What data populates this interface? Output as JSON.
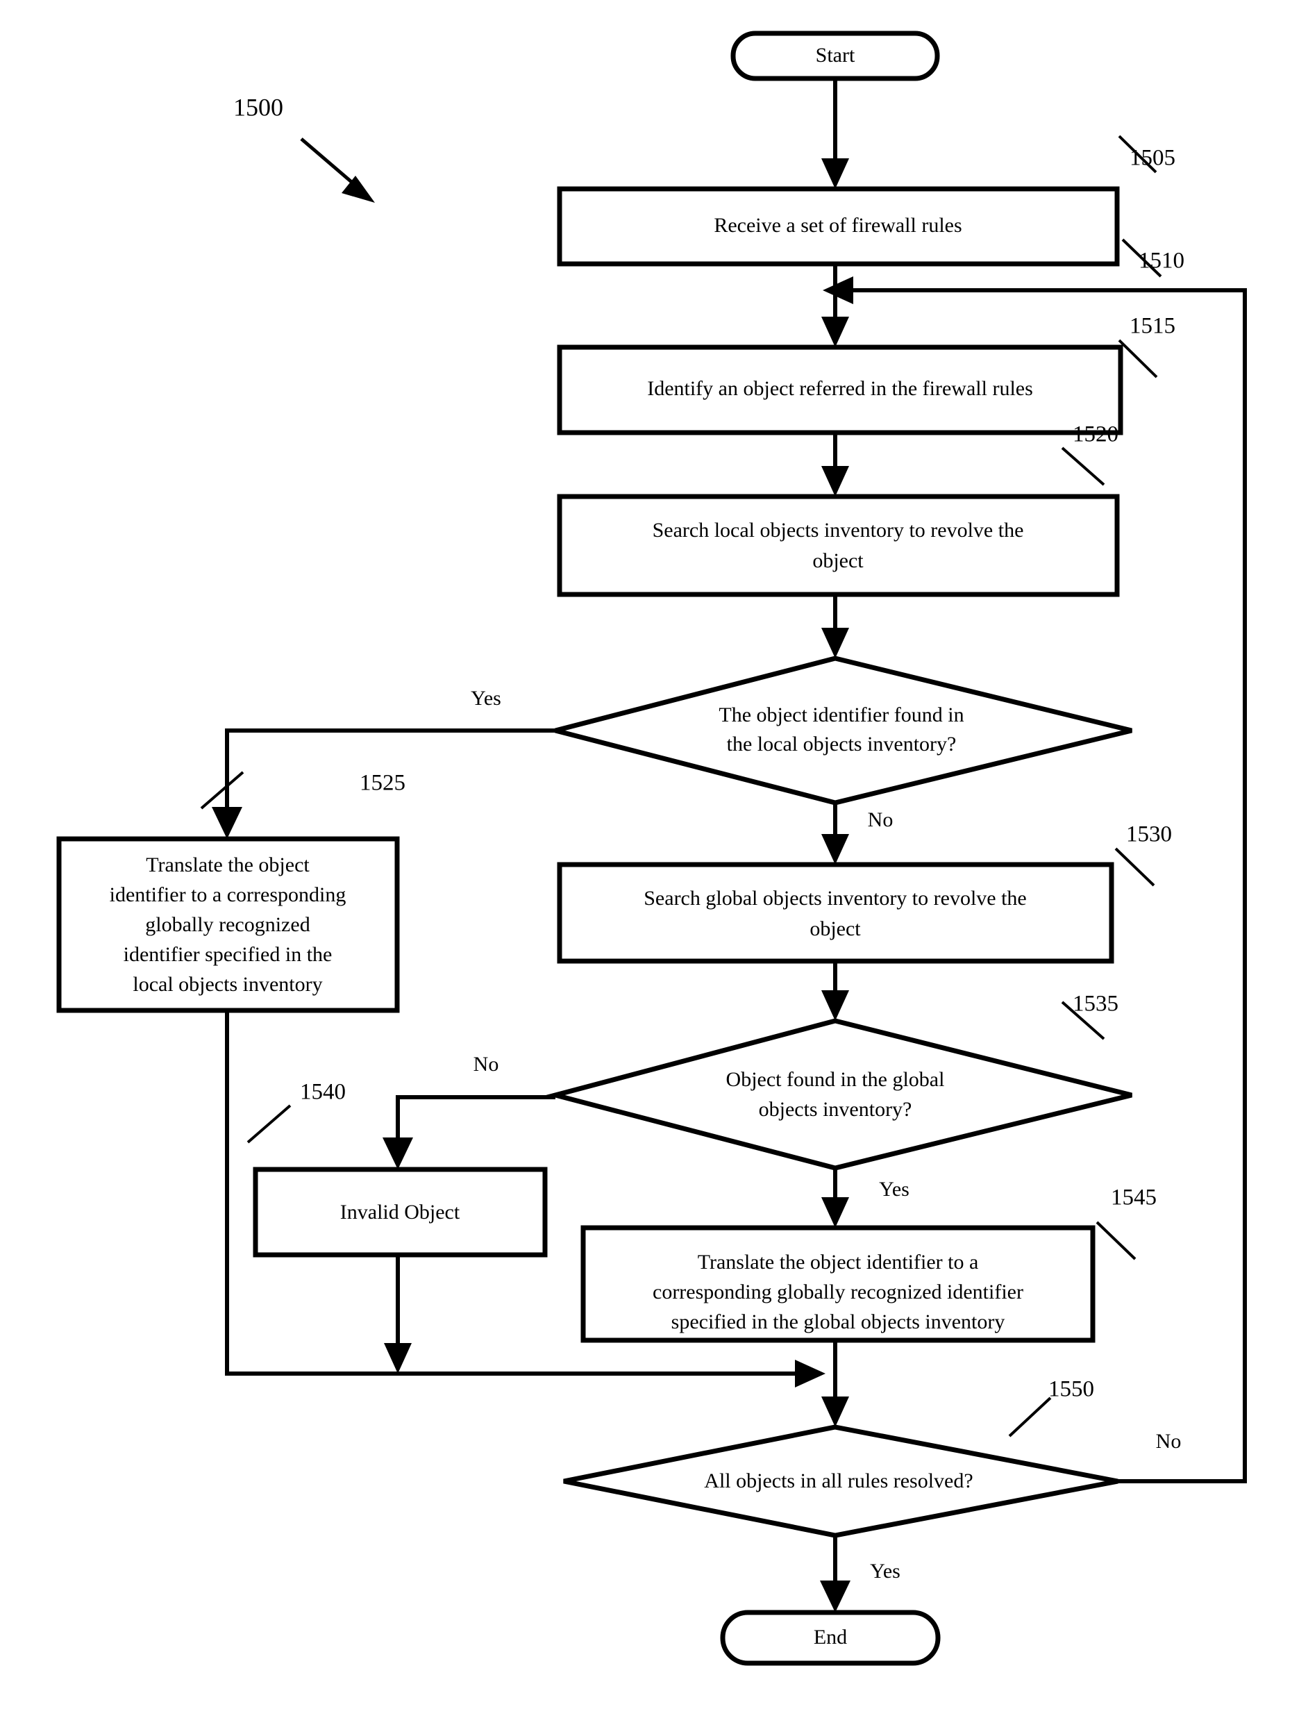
{
  "figure": {
    "number": "1500",
    "type": "flowchart"
  },
  "nodes": {
    "start": {
      "label": "Start",
      "shape": "terminator"
    },
    "receive_rules": {
      "label": "Receive a set of firewall rules",
      "ref": "1505",
      "shape": "process"
    },
    "identify_object": {
      "label": "Identify an object referred in the firewall rules",
      "ref": "1510",
      "shape": "process"
    },
    "search_local": {
      "line1": "Search local objects inventory to revolve the",
      "line2": "object",
      "ref": "1515",
      "shape": "process"
    },
    "decision_local": {
      "line1": "The object identifier found in",
      "line2": "the local objects inventory?",
      "ref": "1520",
      "shape": "decision"
    },
    "translate_local": {
      "line1": "Translate the object",
      "line2": "identifier to a corresponding",
      "line3": "globally recognized",
      "line4": "identifier specified in the",
      "line5": "local objects inventory",
      "ref": "1525",
      "shape": "process"
    },
    "search_global": {
      "line1": "Search global objects inventory to revolve the",
      "line2": "object",
      "ref": "1530",
      "shape": "process"
    },
    "decision_global": {
      "line1": "Object found in the global",
      "line2": "objects inventory?",
      "ref": "1535",
      "shape": "decision"
    },
    "invalid_object": {
      "label": "Invalid Object",
      "ref": "1540",
      "shape": "process"
    },
    "translate_global": {
      "line1": "Translate the object identifier to a",
      "line2": "corresponding globally recognized identifier",
      "line3": "specified in the global objects inventory",
      "ref": "1545",
      "shape": "process"
    },
    "decision_all_resolved": {
      "label": "All objects in all rules resolved?",
      "ref": "1550",
      "shape": "decision"
    },
    "end": {
      "label": "End",
      "shape": "terminator"
    }
  },
  "edge_labels": {
    "local_yes": "Yes",
    "local_no": "No",
    "global_no": "No",
    "global_yes": "Yes",
    "resolved_no": "No",
    "resolved_yes": "Yes"
  },
  "colors": {
    "stroke": "#000000",
    "fill": "#ffffff",
    "text": "#000000"
  }
}
